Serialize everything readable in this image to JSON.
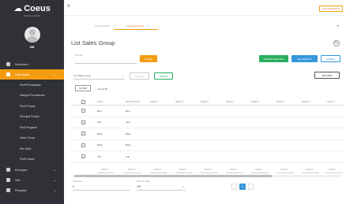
{
  "brand": {
    "name": "Coeus",
    "version": "Version 1.02.01"
  },
  "user": {
    "name": "DB"
  },
  "sidebar": {
    "items": [
      {
        "label": "Dashboard",
        "icon": "dashboard-icon",
        "active": false
      },
      {
        "label": "Data Master",
        "icon": "home-icon",
        "active": true
      }
    ],
    "sub_items": [
      {
        "label": "Profil Perusahaan"
      },
      {
        "label": "Kategori Perusahaan"
      },
      {
        "label": "Profil Produk"
      },
      {
        "label": "Principal Produk"
      },
      {
        "label": "Profil Pegawai"
      },
      {
        "label": "Sales Group"
      },
      {
        "label": "Bon Data"
      },
      {
        "label": "Profil Lokasi"
      }
    ],
    "bottom_items": [
      {
        "label": "Keuangan",
        "icon": "finance-icon"
      },
      {
        "label": "Stok",
        "icon": "stock-icon"
      },
      {
        "label": "Penjualan",
        "icon": "sales-icon"
      }
    ]
  },
  "topbar": {
    "doc_label": "DOKUMENTASI"
  },
  "tabs": [
    {
      "label": "DASHBOARD",
      "active": false
    },
    {
      "label": "SALES GROUP",
      "active": true
    }
  ],
  "page": {
    "title": "List Sales Group"
  },
  "period": {
    "label": "Periode",
    "value": "-"
  },
  "buttons": {
    "cari": "CARI(Z)",
    "simpan_template": "SIMPAN TEMPLATE",
    "set_default": "SET DEFAULT",
    "tambah": "TAMBAH",
    "simpan": "SIMPAN",
    "add_new": "ADD NEW"
  },
  "template_select": {
    "value": "List Sales Group",
    "pilih_label": "PILIH ALL"
  },
  "filter": {
    "label": "FILTER",
    "group_by": "Group By"
  },
  "table": {
    "columns": [
      "NAMA",
      "DESCRIPTION",
      "SELECT",
      "SELECT",
      "SELECT",
      "SELECT",
      "SELECT",
      "SELECT",
      "SELECT",
      "SELECT"
    ],
    "rows": [
      {
        "name": "Ron",
        "desc": "Ron"
      },
      {
        "name": "Jam",
        "desc": "Jam"
      },
      {
        "name": "Rina",
        "desc": "Rina"
      },
      {
        "name": "Rina",
        "desc": "Rina"
      },
      {
        "name": "Yuli",
        "desc": "Yuli"
      }
    ],
    "footer_cols": [
      "SELECT",
      "SELECT",
      "SELECT",
      "SELECT",
      "SELECT",
      "SELECT",
      "SELECT",
      "SELECT",
      "SELECT",
      "SELECT",
      "SELECT"
    ]
  },
  "pagination": {
    "total_label": "Total Data",
    "total_value": "5",
    "per_page_label": "Data Per Page",
    "per_page_value": "100",
    "current_page": "1"
  }
}
